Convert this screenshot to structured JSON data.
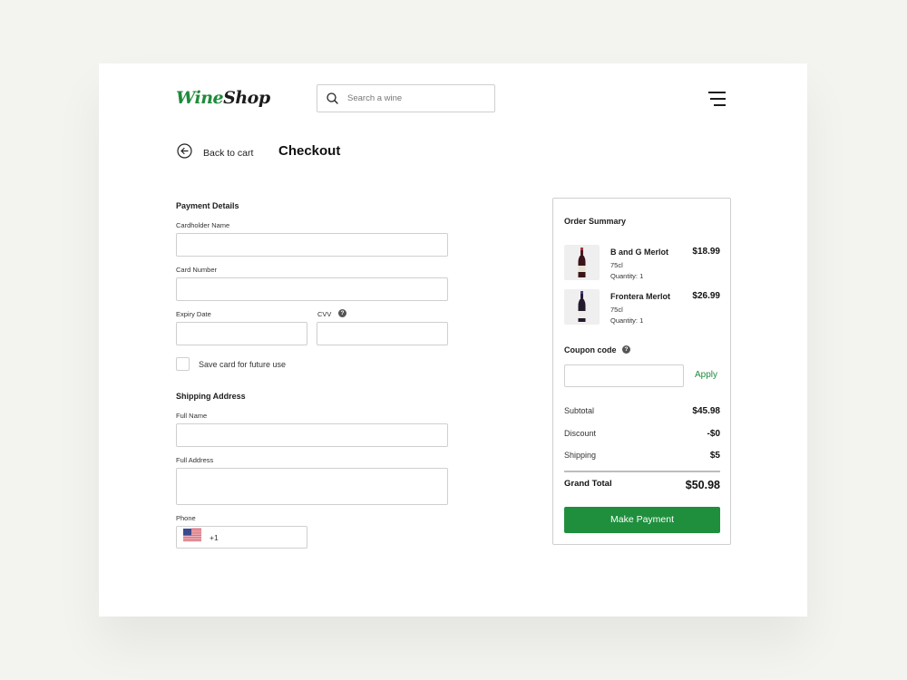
{
  "header": {
    "logo_part1": "Wine",
    "logo_part2": "Shop",
    "search_placeholder": "Search a wine"
  },
  "nav": {
    "back_label": "Back to cart",
    "page_title": "Checkout"
  },
  "payment": {
    "section_title": "Payment Details",
    "cardholder_label": "Cardholder Name",
    "card_number_label": "Card Number",
    "expiry_label": "Expiry Date",
    "cvv_label": "CVV",
    "save_card_label": "Save card for future use"
  },
  "shipping": {
    "section_title": "Shipping Address",
    "full_name_label": "Full Name",
    "full_address_label": "Full Address",
    "phone_label": "Phone",
    "phone_code": "+1"
  },
  "summary": {
    "title": "Order Summary",
    "items": [
      {
        "name": "B and G Merlot",
        "volume": "75cl",
        "quantity": "Quantity: 1",
        "price": "$18.99"
      },
      {
        "name": "Frontera Merlot",
        "volume": "75cl",
        "quantity": "Quantity: 1",
        "price": "$26.99"
      }
    ],
    "coupon_label": "Coupon code",
    "apply_label": "Apply",
    "subtotal_label": "Subtotal",
    "subtotal_value": "$45.98",
    "discount_label": "Discount",
    "discount_value": "-$0",
    "shipping_label": "Shipping",
    "shipping_value": "$5",
    "grand_total_label": "Grand Total",
    "grand_total_value": "$50.98",
    "pay_label": "Make Payment"
  },
  "colors": {
    "brand_green": "#1f8a3b",
    "button_green": "#1f8f3d",
    "background": "#f3f3ef"
  }
}
